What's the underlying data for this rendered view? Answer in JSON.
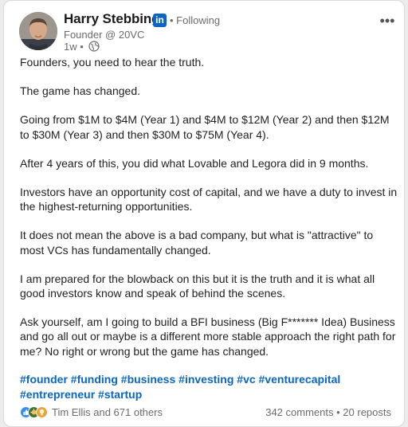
{
  "author": {
    "name": "Harry Stebbings",
    "network_badge": "in",
    "follow_status": "Following",
    "headline": "Founder @ 20VC",
    "time": "1w"
  },
  "post": {
    "paragraphs": [
      "Founders, you need to hear the truth.",
      "The game has changed.",
      "Going from $1M to $4M (Year 1) and $4M to $12M (Year 2) and then $12M to $30M (Year 3) and then $30M to $75M (Year 4).",
      "After 4 years of this, you did what Lovable and Legora did in 9 months.",
      "Investors have an opportunity cost of capital, and we have a duty to invest in the highest-returning opportunities.",
      "It does not mean the above is a bad company, but what is \"attractive\" to most VCs has fundamentally changed.",
      "I am prepared for the blowback on this but it is the truth and it is what all good investors know and speak of behind the scenes.",
      "Ask yourself, am I going to build a BFI business (Big F******* Idea) Business and go all out or maybe is a different more stable approach the right path for me? No right or wrong but the game has changed."
    ],
    "hashtags": [
      "#founder",
      "#funding",
      "#business",
      "#investing",
      "#vc",
      "#venturecapital",
      "#entrepreneur",
      "#startup"
    ]
  },
  "social": {
    "reactions_text": "Tim Ellis and 671 others",
    "comments": "342 comments",
    "separator": "•",
    "reposts": "20 reposts"
  },
  "colors": {
    "link_blue": "#0a66c2",
    "muted_text": "#6b6b6b",
    "body_text": "#1f1f1f"
  },
  "icons": {
    "more": "more-horizontal-icon",
    "visibility": "globe-icon",
    "reactions": [
      "like-icon",
      "celebrate-icon",
      "insightful-icon"
    ]
  }
}
